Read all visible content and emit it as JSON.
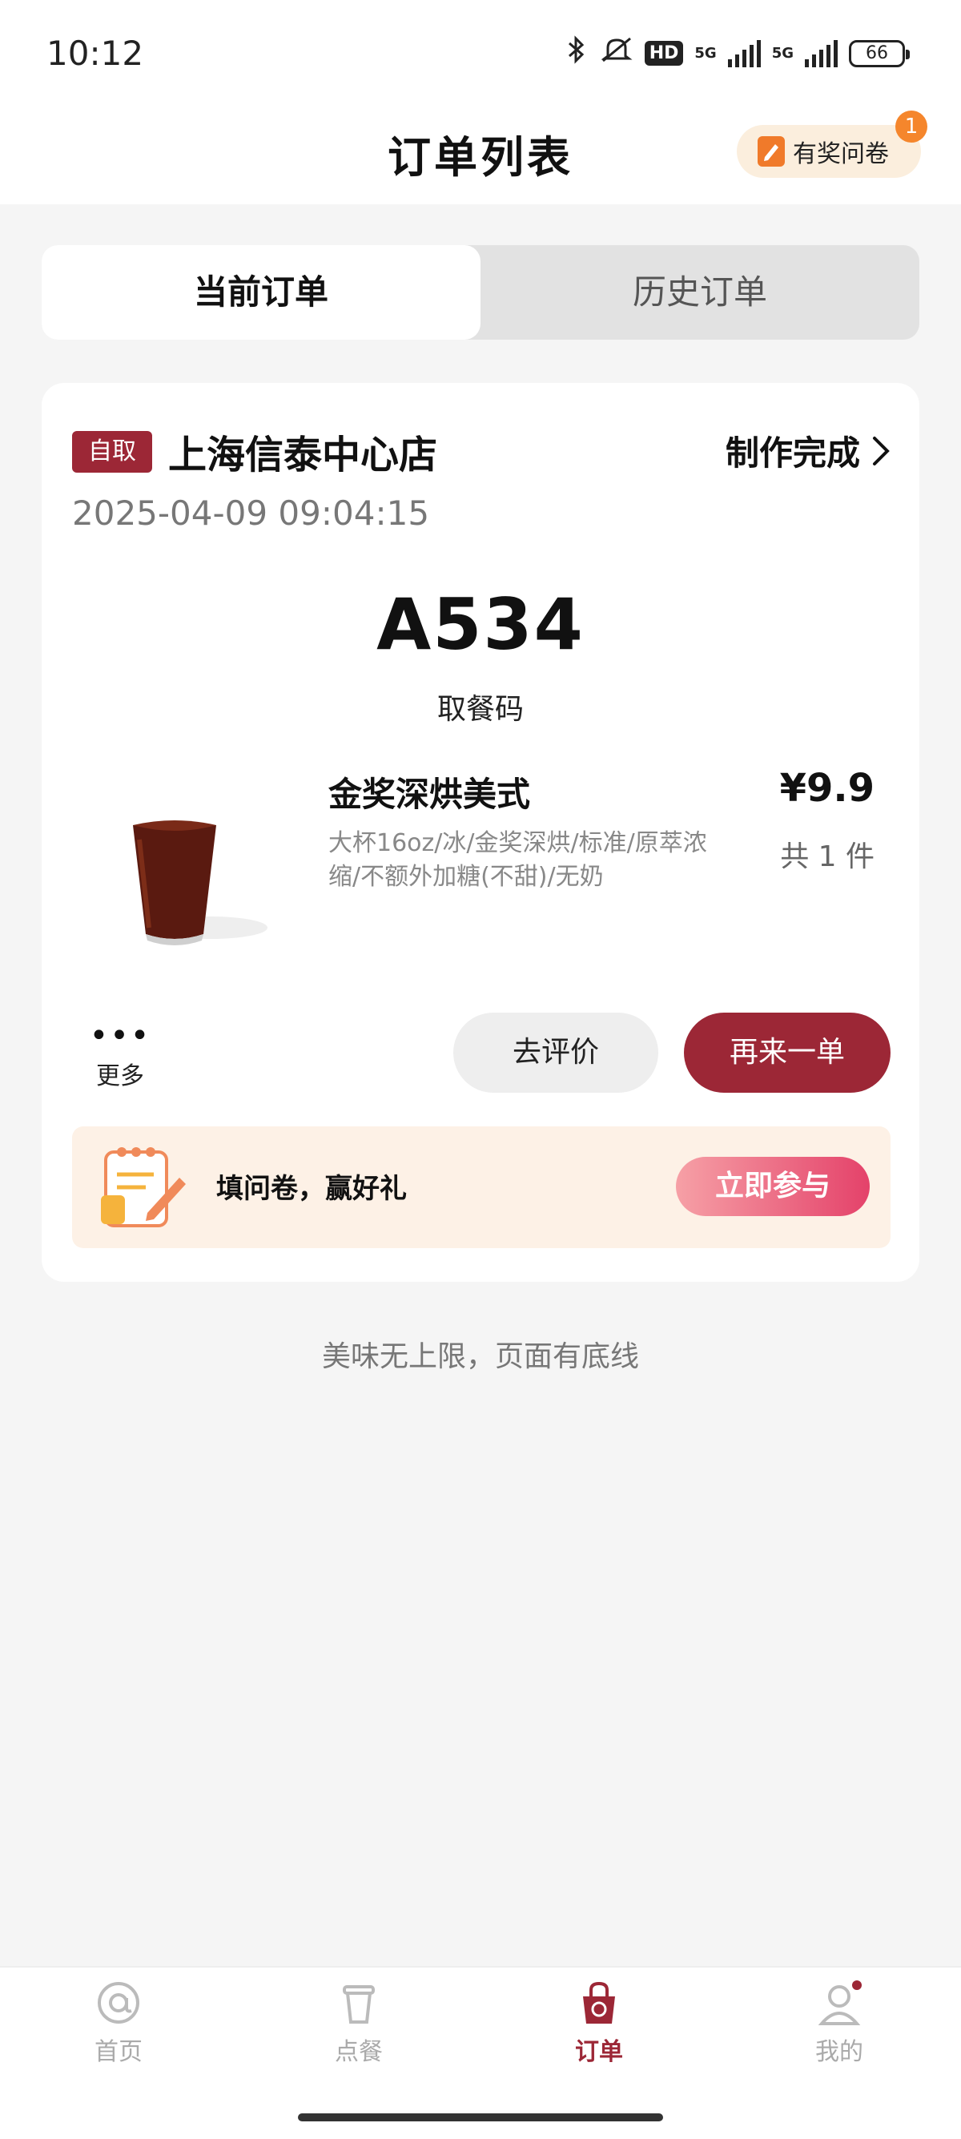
{
  "status_bar": {
    "time": "10:12",
    "hd_label": "HD",
    "network_label": "5G",
    "battery": "66"
  },
  "header": {
    "title": "订单列表",
    "survey_chip_label": "有奖问卷",
    "survey_badge": "1"
  },
  "tabs": [
    {
      "label": "当前订单",
      "active": true
    },
    {
      "label": "历史订单",
      "active": false
    }
  ],
  "order": {
    "pickup_type": "自取",
    "store_name": "上海信泰中心店",
    "status": "制作完成",
    "time": "2025-04-09 09:04:15",
    "pickup_code": "A534",
    "pickup_code_label": "取餐码",
    "item": {
      "name": "金奖深烘美式",
      "options": "大杯16oz/冰/金奖深烘/标准/原萃浓缩/不额外加糖(不甜)/无奶",
      "price": "¥9.9",
      "quantity": "共 1 件"
    },
    "more_label": "更多",
    "review_button": "去评价",
    "reorder_button": "再来一单",
    "survey_banner": {
      "text": "填问卷，赢好礼",
      "button": "立即参与"
    }
  },
  "footer_note": "美味无上限，页面有底线",
  "bottom_nav": [
    {
      "label": "首页",
      "icon": "home-icon",
      "active": false
    },
    {
      "label": "点餐",
      "icon": "cup-icon",
      "active": false
    },
    {
      "label": "订单",
      "icon": "order-bag-icon",
      "active": true
    },
    {
      "label": "我的",
      "icon": "profile-icon",
      "active": false
    }
  ],
  "colors": {
    "brand": "#9c2736",
    "survey_orange": "#f5862c",
    "page_bg": "#f5f5f5"
  }
}
